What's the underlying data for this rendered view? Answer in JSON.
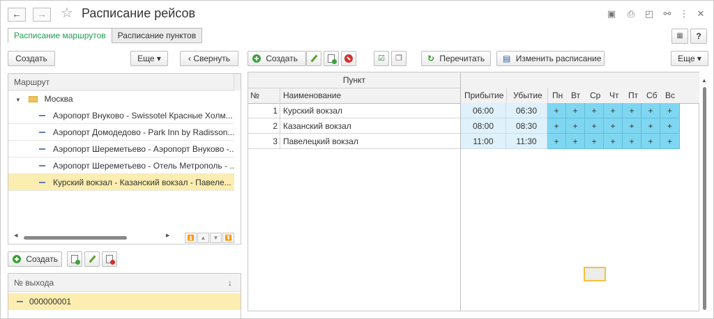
{
  "window": {
    "title": "Расписание рейсов",
    "nav_back": "←",
    "nav_forward": "→"
  },
  "tabs": [
    {
      "label": "Расписание маршрутов",
      "active": true
    },
    {
      "label": "Расписание пунктов",
      "active": false
    }
  ],
  "top_right": {
    "help": "?"
  },
  "left_toolbar": {
    "create": "Создать",
    "more": "Еще ▾",
    "collapse": "‹  Свернуть"
  },
  "main_toolbar": {
    "create": "Создать",
    "reread": "Перечитать",
    "change_schedule": "Изменить расписание",
    "more": "Еще ▾"
  },
  "routes": {
    "header": "Маршрут",
    "group": "Москва",
    "items": [
      {
        "label": "Аэропорт Внуково - Swissotel Красные Холм...",
        "selected": false
      },
      {
        "label": "Аэропорт Домодедово - Park Inn by Radisson...",
        "selected": false
      },
      {
        "label": "Аэропорт Шереметьево - Аэропорт Внуково -...",
        "selected": false
      },
      {
        "label": "Аэропорт Шереметьево - Отель Метрополь - ...",
        "selected": false
      },
      {
        "label": "Курский вокзал - Казанский вокзал - Павеле...",
        "selected": true
      }
    ]
  },
  "gates": {
    "create": "Создать",
    "header": "№ выхода",
    "sort_icon": "↓",
    "rows": [
      {
        "label": "000000001"
      }
    ]
  },
  "schedule": {
    "group_header": "Пункт",
    "col_no": "№",
    "col_name": "Наименование",
    "col_arrival": "Прибытие",
    "col_departure": "Убытие",
    "days": [
      "Пн",
      "Вт",
      "Ср",
      "Чт",
      "Пт",
      "Сб",
      "Вс"
    ],
    "rows": [
      {
        "no": "1",
        "name": "Курский вокзал",
        "arrival": "06:00",
        "departure": "06:30",
        "days": [
          "+",
          "+",
          "+",
          "+",
          "+",
          "+",
          "+"
        ]
      },
      {
        "no": "2",
        "name": "Казанский вокзал",
        "arrival": "08:00",
        "departure": "08:30",
        "days": [
          "+",
          "+",
          "+",
          "+",
          "+",
          "+",
          "+"
        ]
      },
      {
        "no": "3",
        "name": "Павелецкий вокзал",
        "arrival": "11:00",
        "departure": "11:30",
        "days": [
          "+",
          "+",
          "+",
          "+",
          "+",
          "+",
          "+"
        ]
      }
    ]
  },
  "colors": {
    "accent_green": "#1f9b4f",
    "selection": "#fcedb0",
    "day_cell": "#7fd6f0",
    "time_cell": "#dff1fb"
  }
}
